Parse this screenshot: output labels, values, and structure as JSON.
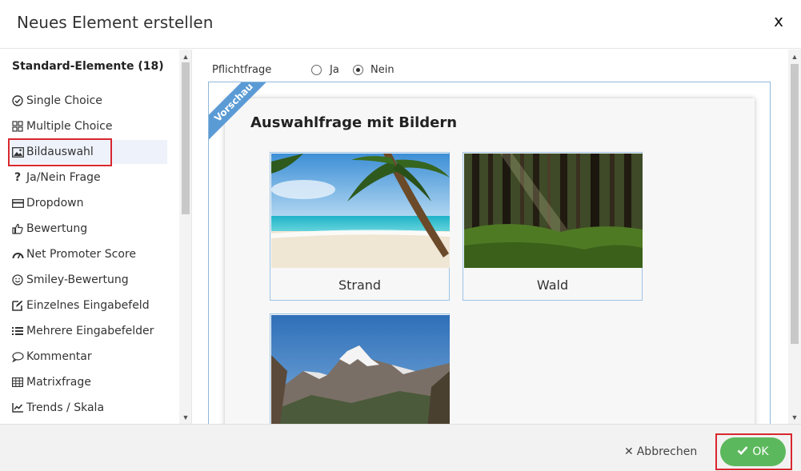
{
  "dialog": {
    "title": "Neues Element erstellen",
    "close_label": "x"
  },
  "sidebar": {
    "heading": "Standard-Elemente (18)",
    "items": [
      {
        "label": "Single Choice",
        "icon": "radio-check-icon"
      },
      {
        "label": "Multiple Choice",
        "icon": "grid-icon"
      },
      {
        "label": "Bildauswahl",
        "icon": "image-icon"
      },
      {
        "label": "Ja/Nein Frage",
        "icon": "question-icon"
      },
      {
        "label": "Dropdown",
        "icon": "dropdown-icon"
      },
      {
        "label": "Bewertung",
        "icon": "thumbs-up-icon"
      },
      {
        "label": "Net Promoter Score",
        "icon": "gauge-icon"
      },
      {
        "label": "Smiley-Bewertung",
        "icon": "smiley-icon"
      },
      {
        "label": "Einzelnes Eingabefeld",
        "icon": "edit-icon"
      },
      {
        "label": "Mehrere Eingabefelder",
        "icon": "list-icon"
      },
      {
        "label": "Kommentar",
        "icon": "comment-icon"
      },
      {
        "label": "Matrixfrage",
        "icon": "table-icon"
      },
      {
        "label": "Trends / Skala",
        "icon": "chart-icon"
      }
    ],
    "selected": "Bildauswahl"
  },
  "main": {
    "required_label": "Pflichtfrage",
    "options": [
      {
        "label": "Ja",
        "checked": false
      },
      {
        "label": "Nein",
        "checked": true
      }
    ],
    "preview": {
      "ribbon": "Vorschau",
      "question_title": "Auswahlfrage mit Bildern",
      "choices": [
        {
          "label": "Strand"
        },
        {
          "label": "Wald"
        },
        {
          "label": ""
        }
      ]
    }
  },
  "footer": {
    "cancel_label": "Abbrechen",
    "ok_label": "OK"
  },
  "colors": {
    "accent_blue": "#5b9bd5",
    "ok_green": "#5cb85c",
    "highlight_red": "#d9272f"
  }
}
